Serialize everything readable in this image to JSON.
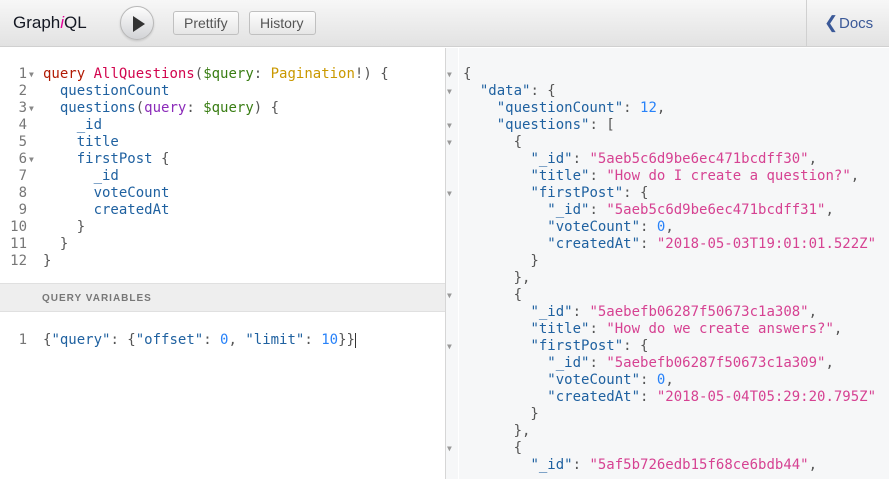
{
  "toolbar": {
    "logo_prefix": "Graph",
    "logo_i": "i",
    "logo_suffix": "QL",
    "prettify_label": "Prettify",
    "history_label": "History",
    "docs_label": "Docs",
    "docs_chevron": "❮"
  },
  "query_editor": {
    "line_numbers": [
      "1",
      "2",
      "3",
      "4",
      "5",
      "6",
      "7",
      "8",
      "9",
      "10",
      "11",
      "12"
    ],
    "fold_markers": [
      "▼",
      "",
      "▼",
      "",
      "",
      "▼",
      "",
      "",
      "",
      "",
      "",
      ""
    ],
    "lines": [
      [
        {
          "c": "k",
          "t": "query"
        },
        {
          "c": "p",
          "t": " "
        },
        {
          "c": "d",
          "t": "AllQuestions"
        },
        {
          "c": "p",
          "t": "("
        },
        {
          "c": "v",
          "t": "$query"
        },
        {
          "c": "p",
          "t": ": "
        },
        {
          "c": "t",
          "t": "Pagination"
        },
        {
          "c": "p",
          "t": "!) {"
        }
      ],
      [
        {
          "c": "p",
          "t": "  "
        },
        {
          "c": "f",
          "t": "questionCount"
        }
      ],
      [
        {
          "c": "p",
          "t": "  "
        },
        {
          "c": "f",
          "t": "questions"
        },
        {
          "c": "p",
          "t": "("
        },
        {
          "c": "a",
          "t": "query"
        },
        {
          "c": "p",
          "t": ": "
        },
        {
          "c": "v",
          "t": "$query"
        },
        {
          "c": "p",
          "t": ") {"
        }
      ],
      [
        {
          "c": "p",
          "t": "    "
        },
        {
          "c": "f",
          "t": "_id"
        }
      ],
      [
        {
          "c": "p",
          "t": "    "
        },
        {
          "c": "f",
          "t": "title"
        }
      ],
      [
        {
          "c": "p",
          "t": "    "
        },
        {
          "c": "f",
          "t": "firstPost"
        },
        {
          "c": "p",
          "t": " {"
        }
      ],
      [
        {
          "c": "p",
          "t": "      "
        },
        {
          "c": "f",
          "t": "_id"
        }
      ],
      [
        {
          "c": "p",
          "t": "      "
        },
        {
          "c": "f",
          "t": "voteCount"
        }
      ],
      [
        {
          "c": "p",
          "t": "      "
        },
        {
          "c": "f",
          "t": "createdAt"
        }
      ],
      [
        {
          "c": "p",
          "t": "    }"
        }
      ],
      [
        {
          "c": "p",
          "t": "  }"
        }
      ],
      [
        {
          "c": "p",
          "t": "}"
        }
      ]
    ]
  },
  "variables": {
    "title": "QUERY VARIABLES",
    "line_numbers": [
      "1"
    ],
    "lines": [
      [
        {
          "c": "p",
          "t": "{"
        },
        {
          "c": "j",
          "t": "\"query\""
        },
        {
          "c": "p",
          "t": ": {"
        },
        {
          "c": "j",
          "t": "\"offset\""
        },
        {
          "c": "p",
          "t": ": "
        },
        {
          "c": "n",
          "t": "0"
        },
        {
          "c": "p",
          "t": ", "
        },
        {
          "c": "j",
          "t": "\"limit\""
        },
        {
          "c": "p",
          "t": ": "
        },
        {
          "c": "n",
          "t": "10"
        },
        {
          "c": "p",
          "t": "}}"
        }
      ]
    ]
  },
  "result": {
    "fold_markers": [
      "▼",
      "▼",
      "",
      "▼",
      "▼",
      "",
      "",
      "▼",
      "",
      "",
      "",
      "",
      "",
      "▼",
      "",
      "",
      "▼",
      "",
      "",
      "",
      "",
      "",
      "▼",
      "",
      ""
    ],
    "lines": [
      [
        {
          "c": "p",
          "t": "{"
        }
      ],
      [
        {
          "c": "p",
          "t": "  "
        },
        {
          "c": "j",
          "t": "\"data\""
        },
        {
          "c": "p",
          "t": ": {"
        }
      ],
      [
        {
          "c": "p",
          "t": "    "
        },
        {
          "c": "j",
          "t": "\"questionCount\""
        },
        {
          "c": "p",
          "t": ": "
        },
        {
          "c": "n",
          "t": "12"
        },
        {
          "c": "p",
          "t": ","
        }
      ],
      [
        {
          "c": "p",
          "t": "    "
        },
        {
          "c": "j",
          "t": "\"questions\""
        },
        {
          "c": "p",
          "t": ": ["
        }
      ],
      [
        {
          "c": "p",
          "t": "      {"
        }
      ],
      [
        {
          "c": "p",
          "t": "        "
        },
        {
          "c": "j",
          "t": "\"_id\""
        },
        {
          "c": "p",
          "t": ": "
        },
        {
          "c": "s",
          "t": "\"5aeb5c6d9be6ec471bcdff30\""
        },
        {
          "c": "p",
          "t": ","
        }
      ],
      [
        {
          "c": "p",
          "t": "        "
        },
        {
          "c": "j",
          "t": "\"title\""
        },
        {
          "c": "p",
          "t": ": "
        },
        {
          "c": "s",
          "t": "\"How do I create a question?\""
        },
        {
          "c": "p",
          "t": ","
        }
      ],
      [
        {
          "c": "p",
          "t": "        "
        },
        {
          "c": "j",
          "t": "\"firstPost\""
        },
        {
          "c": "p",
          "t": ": {"
        }
      ],
      [
        {
          "c": "p",
          "t": "          "
        },
        {
          "c": "j",
          "t": "\"_id\""
        },
        {
          "c": "p",
          "t": ": "
        },
        {
          "c": "s",
          "t": "\"5aeb5c6d9be6ec471bcdff31\""
        },
        {
          "c": "p",
          "t": ","
        }
      ],
      [
        {
          "c": "p",
          "t": "          "
        },
        {
          "c": "j",
          "t": "\"voteCount\""
        },
        {
          "c": "p",
          "t": ": "
        },
        {
          "c": "n",
          "t": "0"
        },
        {
          "c": "p",
          "t": ","
        }
      ],
      [
        {
          "c": "p",
          "t": "          "
        },
        {
          "c": "j",
          "t": "\"createdAt\""
        },
        {
          "c": "p",
          "t": ": "
        },
        {
          "c": "s",
          "t": "\"2018-05-03T19:01:01.522Z\""
        }
      ],
      [
        {
          "c": "p",
          "t": "        }"
        }
      ],
      [
        {
          "c": "p",
          "t": "      },"
        }
      ],
      [
        {
          "c": "p",
          "t": "      {"
        }
      ],
      [
        {
          "c": "p",
          "t": "        "
        },
        {
          "c": "j",
          "t": "\"_id\""
        },
        {
          "c": "p",
          "t": ": "
        },
        {
          "c": "s",
          "t": "\"5aebefb06287f50673c1a308\""
        },
        {
          "c": "p",
          "t": ","
        }
      ],
      [
        {
          "c": "p",
          "t": "        "
        },
        {
          "c": "j",
          "t": "\"title\""
        },
        {
          "c": "p",
          "t": ": "
        },
        {
          "c": "s",
          "t": "\"How do we create answers?\""
        },
        {
          "c": "p",
          "t": ","
        }
      ],
      [
        {
          "c": "p",
          "t": "        "
        },
        {
          "c": "j",
          "t": "\"firstPost\""
        },
        {
          "c": "p",
          "t": ": {"
        }
      ],
      [
        {
          "c": "p",
          "t": "          "
        },
        {
          "c": "j",
          "t": "\"_id\""
        },
        {
          "c": "p",
          "t": ": "
        },
        {
          "c": "s",
          "t": "\"5aebefb06287f50673c1a309\""
        },
        {
          "c": "p",
          "t": ","
        }
      ],
      [
        {
          "c": "p",
          "t": "          "
        },
        {
          "c": "j",
          "t": "\"voteCount\""
        },
        {
          "c": "p",
          "t": ": "
        },
        {
          "c": "n",
          "t": "0"
        },
        {
          "c": "p",
          "t": ","
        }
      ],
      [
        {
          "c": "p",
          "t": "          "
        },
        {
          "c": "j",
          "t": "\"createdAt\""
        },
        {
          "c": "p",
          "t": ": "
        },
        {
          "c": "s",
          "t": "\"2018-05-04T05:29:20.795Z\""
        }
      ],
      [
        {
          "c": "p",
          "t": "        }"
        }
      ],
      [
        {
          "c": "p",
          "t": "      },"
        }
      ],
      [
        {
          "c": "p",
          "t": "      {"
        }
      ],
      [
        {
          "c": "p",
          "t": "        "
        },
        {
          "c": "j",
          "t": "\"_id\""
        },
        {
          "c": "p",
          "t": ": "
        },
        {
          "c": "s",
          "t": "\"5af5b726edb15f68ce6bdb44\""
        },
        {
          "c": "p",
          "t": ","
        }
      ]
    ]
  }
}
